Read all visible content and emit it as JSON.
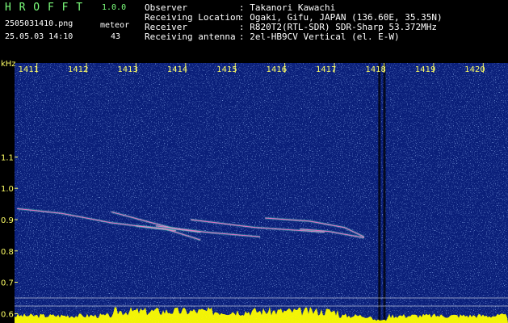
{
  "header": {
    "app_name": "H R O F F T",
    "version": "1.0.0",
    "filename": "2505031410.png",
    "meteor_label": "meteor",
    "datetime": "25.05.03 14:10",
    "meteor_count": "43",
    "info_labels": [
      "Observer",
      "Receiving Location",
      "Receiver",
      "Receiving antenna"
    ],
    "info_values": [
      ": Takanori Kawachi",
      ": Ogaki, Gifu, JAPAN (136.60E, 35.35N)",
      ": R820T2(RTL-SDR) SDR-Sharp 53.372MHz",
      ": 2el-HB9CV Vertical (el. E-W)"
    ]
  },
  "chart_data": {
    "type": "heatmap",
    "x_unit": "time (HHMM)",
    "ylabel": "kHz",
    "x_ticks": [
      "1411",
      "1412",
      "1413",
      "1414",
      "1415",
      "1416",
      "1417",
      "1418",
      "1419",
      "1420"
    ],
    "y_ticks": [
      "1.1",
      "1.0",
      "0.9",
      "0.8",
      "0.7",
      "0.6"
    ],
    "y_values": [
      1.1,
      1.0,
      0.9,
      0.8,
      0.7,
      0.6
    ],
    "ylim": [
      0.57,
      1.4
    ],
    "xlim": [
      1410.55,
      1420.5
    ],
    "carrier_khz": 0.875,
    "meteor_traces": [
      {
        "x": [
          1410.6,
          1411.5,
          1412.5,
          1413.8
        ],
        "y": [
          0.935,
          0.92,
          0.89,
          0.865
        ]
      },
      {
        "x": [
          1412.5,
          1413.2,
          1413.8,
          1414.3
        ],
        "y": [
          0.925,
          0.895,
          0.87,
          0.86
        ]
      },
      {
        "x": [
          1413.4,
          1414.4,
          1415.5
        ],
        "y": [
          0.88,
          0.86,
          0.845
        ]
      },
      {
        "x": [
          1414.1,
          1415.4,
          1416.8
        ],
        "y": [
          0.9,
          0.875,
          0.86
        ]
      },
      {
        "x": [
          1415.6,
          1416.5,
          1417.2,
          1417.6
        ],
        "y": [
          0.905,
          0.895,
          0.875,
          0.845
        ]
      },
      {
        "x": [
          1416.3,
          1416.9,
          1417.6
        ],
        "y": [
          0.87,
          0.862,
          0.842
        ]
      },
      {
        "x": [
          1413.0,
          1413.6,
          1414.3
        ],
        "y": [
          0.88,
          0.87,
          0.835
        ]
      }
    ],
    "dark_columns_x": [
      1417.9,
      1418.0
    ],
    "colors": {
      "background": "#0a1f7a",
      "carrier": "#66ffcc",
      "meteor": "#ff66cc",
      "baseline": "#ffff00",
      "tick_text": "#ffff66"
    }
  }
}
